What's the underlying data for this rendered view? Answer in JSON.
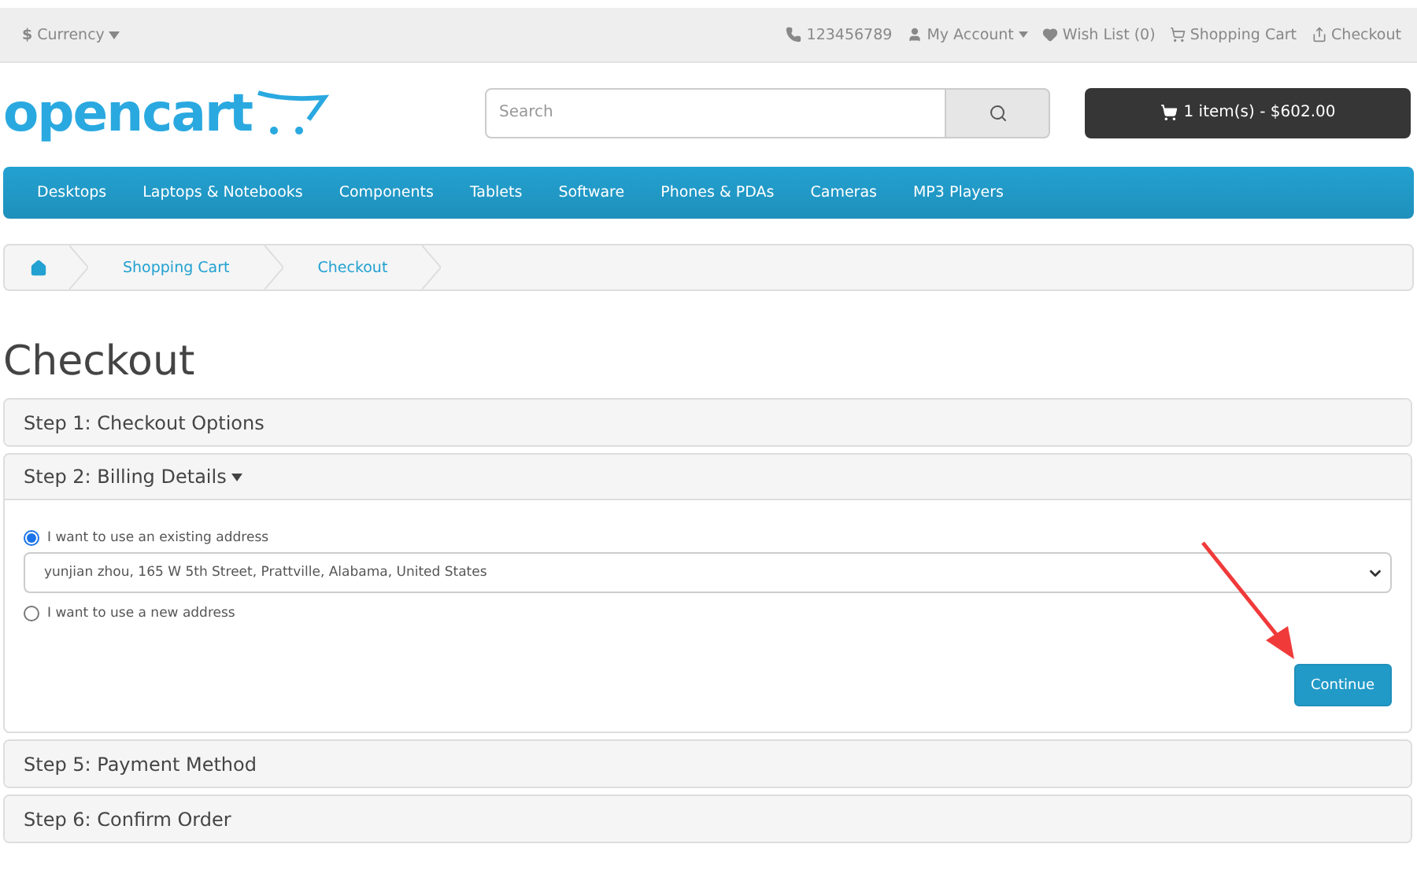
{
  "top_bar": {
    "currency": {
      "symbol": "$",
      "label": "Currency"
    },
    "links": [
      {
        "kind": "phone",
        "label": "123456789",
        "dropdown": false
      },
      {
        "kind": "account",
        "label": "My Account",
        "dropdown": true
      },
      {
        "kind": "wishlist",
        "label": "Wish List (0)",
        "dropdown": false
      },
      {
        "kind": "cart",
        "label": "Shopping Cart",
        "dropdown": false
      },
      {
        "kind": "checkout",
        "label": "Checkout",
        "dropdown": false
      }
    ]
  },
  "header": {
    "logo": "opencart",
    "search": {
      "placeholder": "Search"
    },
    "cart_button": "1 item(s) - $602.00"
  },
  "nav": [
    "Desktops",
    "Laptops & Notebooks",
    "Components",
    "Tablets",
    "Software",
    "Phones & PDAs",
    "Cameras",
    "MP3 Players"
  ],
  "breadcrumb": [
    "Shopping Cart",
    "Checkout"
  ],
  "page_title": "Checkout",
  "steps": [
    {
      "title": "Step 1: Checkout Options",
      "expanded": false
    },
    {
      "title": "Step 2: Billing Details",
      "expanded": true,
      "options": [
        {
          "label": "I want to use an existing address",
          "selected": true
        },
        {
          "label": "I want to use a new address",
          "selected": false
        }
      ],
      "address": "yunjian zhou, 165 W 5th Street, Prattville, Alabama, United States",
      "button": "Continue"
    },
    {
      "title": "Step 5: Payment Method",
      "expanded": false
    },
    {
      "title": "Step 6: Confirm Order",
      "expanded": false
    }
  ]
}
